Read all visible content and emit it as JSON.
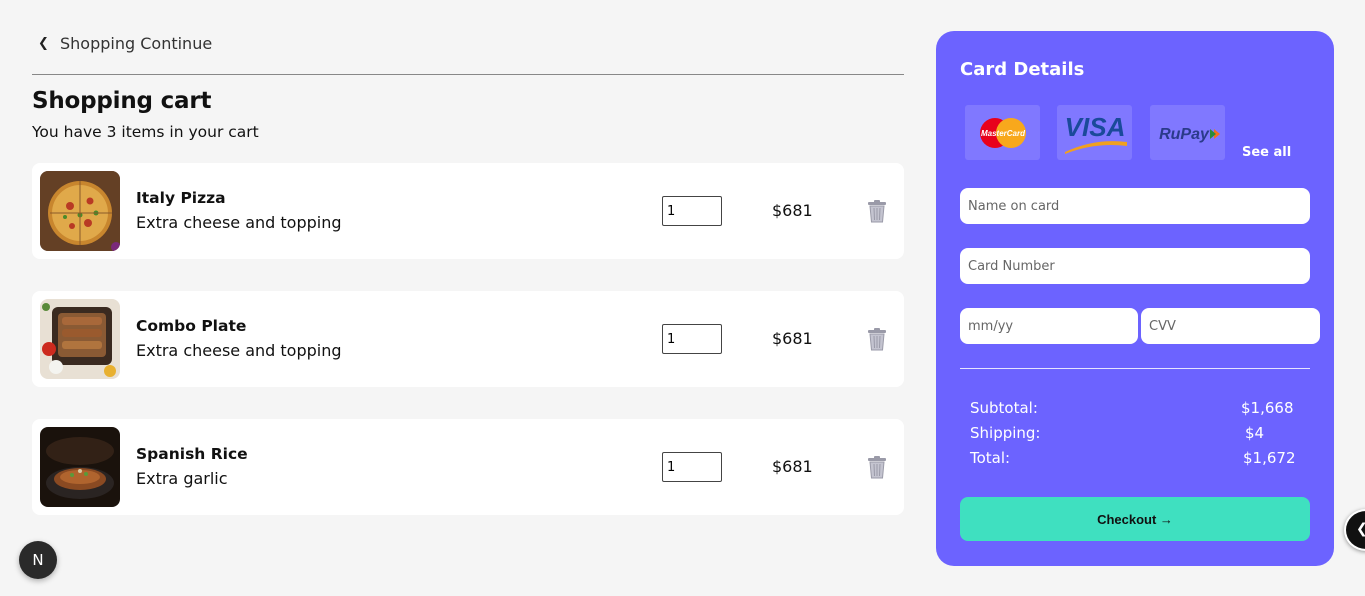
{
  "nav": {
    "back_icon": "chevron-left-icon",
    "back_label": "Shopping Continue"
  },
  "cart": {
    "title": "Shopping cart",
    "subtitle": "You have 3 items in your cart",
    "items": [
      {
        "name": "Italy Pizza",
        "description": "Extra cheese and topping",
        "quantity": "1",
        "price": "$681"
      },
      {
        "name": "Combo Plate",
        "description": "Extra cheese and topping",
        "quantity": "1",
        "price": "$681"
      },
      {
        "name": "Spanish Rice",
        "description": "Extra garlic",
        "quantity": "1",
        "price": "$681"
      }
    ]
  },
  "card": {
    "title": "Card Details",
    "logos": [
      "MasterCard",
      "VISA",
      "RuPay"
    ],
    "see_all": "See all",
    "placeholders": {
      "name": "Name on card",
      "number": "Card Number",
      "expiry": "mm/yy",
      "cvv": "CVV"
    }
  },
  "summary": {
    "subtotal_label": "Subtotal:",
    "subtotal": "$1,668",
    "shipping_label": "Shipping:",
    "shipping": "$4",
    "total_label": "Total:",
    "total": "$1,672"
  },
  "checkout_label": "Checkout →",
  "badge": "N",
  "colors": {
    "panel": "#6c63ff",
    "checkout": "#3fe0c0",
    "background": "#f5f5f5"
  }
}
